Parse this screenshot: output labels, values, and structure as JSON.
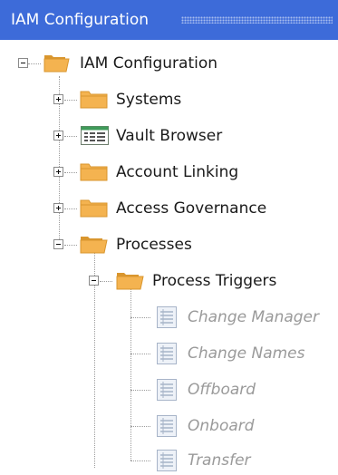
{
  "panel": {
    "title": "IAM Configuration"
  },
  "tree": {
    "root": {
      "label": "IAM Configuration",
      "icon": "folder-open-icon",
      "expanded": true
    },
    "items": [
      {
        "label": "Systems",
        "icon": "folder-icon",
        "expanded": false
      },
      {
        "label": "Vault Browser",
        "icon": "vault-browser-icon",
        "expanded": false
      },
      {
        "label": "Account Linking",
        "icon": "folder-icon",
        "expanded": false
      },
      {
        "label": "Access Governance",
        "icon": "folder-icon",
        "expanded": false
      },
      {
        "label": "Processes",
        "icon": "folder-open-icon",
        "expanded": true
      }
    ],
    "process_triggers": {
      "label": "Process Triggers",
      "icon": "folder-open-icon",
      "expanded": true
    },
    "triggers": [
      {
        "label": "Change Manager",
        "icon": "document-icon",
        "disabled": true
      },
      {
        "label": "Change Names",
        "icon": "document-icon",
        "disabled": true
      },
      {
        "label": "Offboard",
        "icon": "document-icon",
        "disabled": true
      },
      {
        "label": "Onboard",
        "icon": "document-icon",
        "disabled": true
      },
      {
        "label": "Transfer",
        "icon": "document-icon",
        "disabled": true
      }
    ]
  },
  "colors": {
    "titlebar": "#3d6bd9",
    "folder": "#f4b350",
    "disabled_text": "#9a9a9a"
  }
}
